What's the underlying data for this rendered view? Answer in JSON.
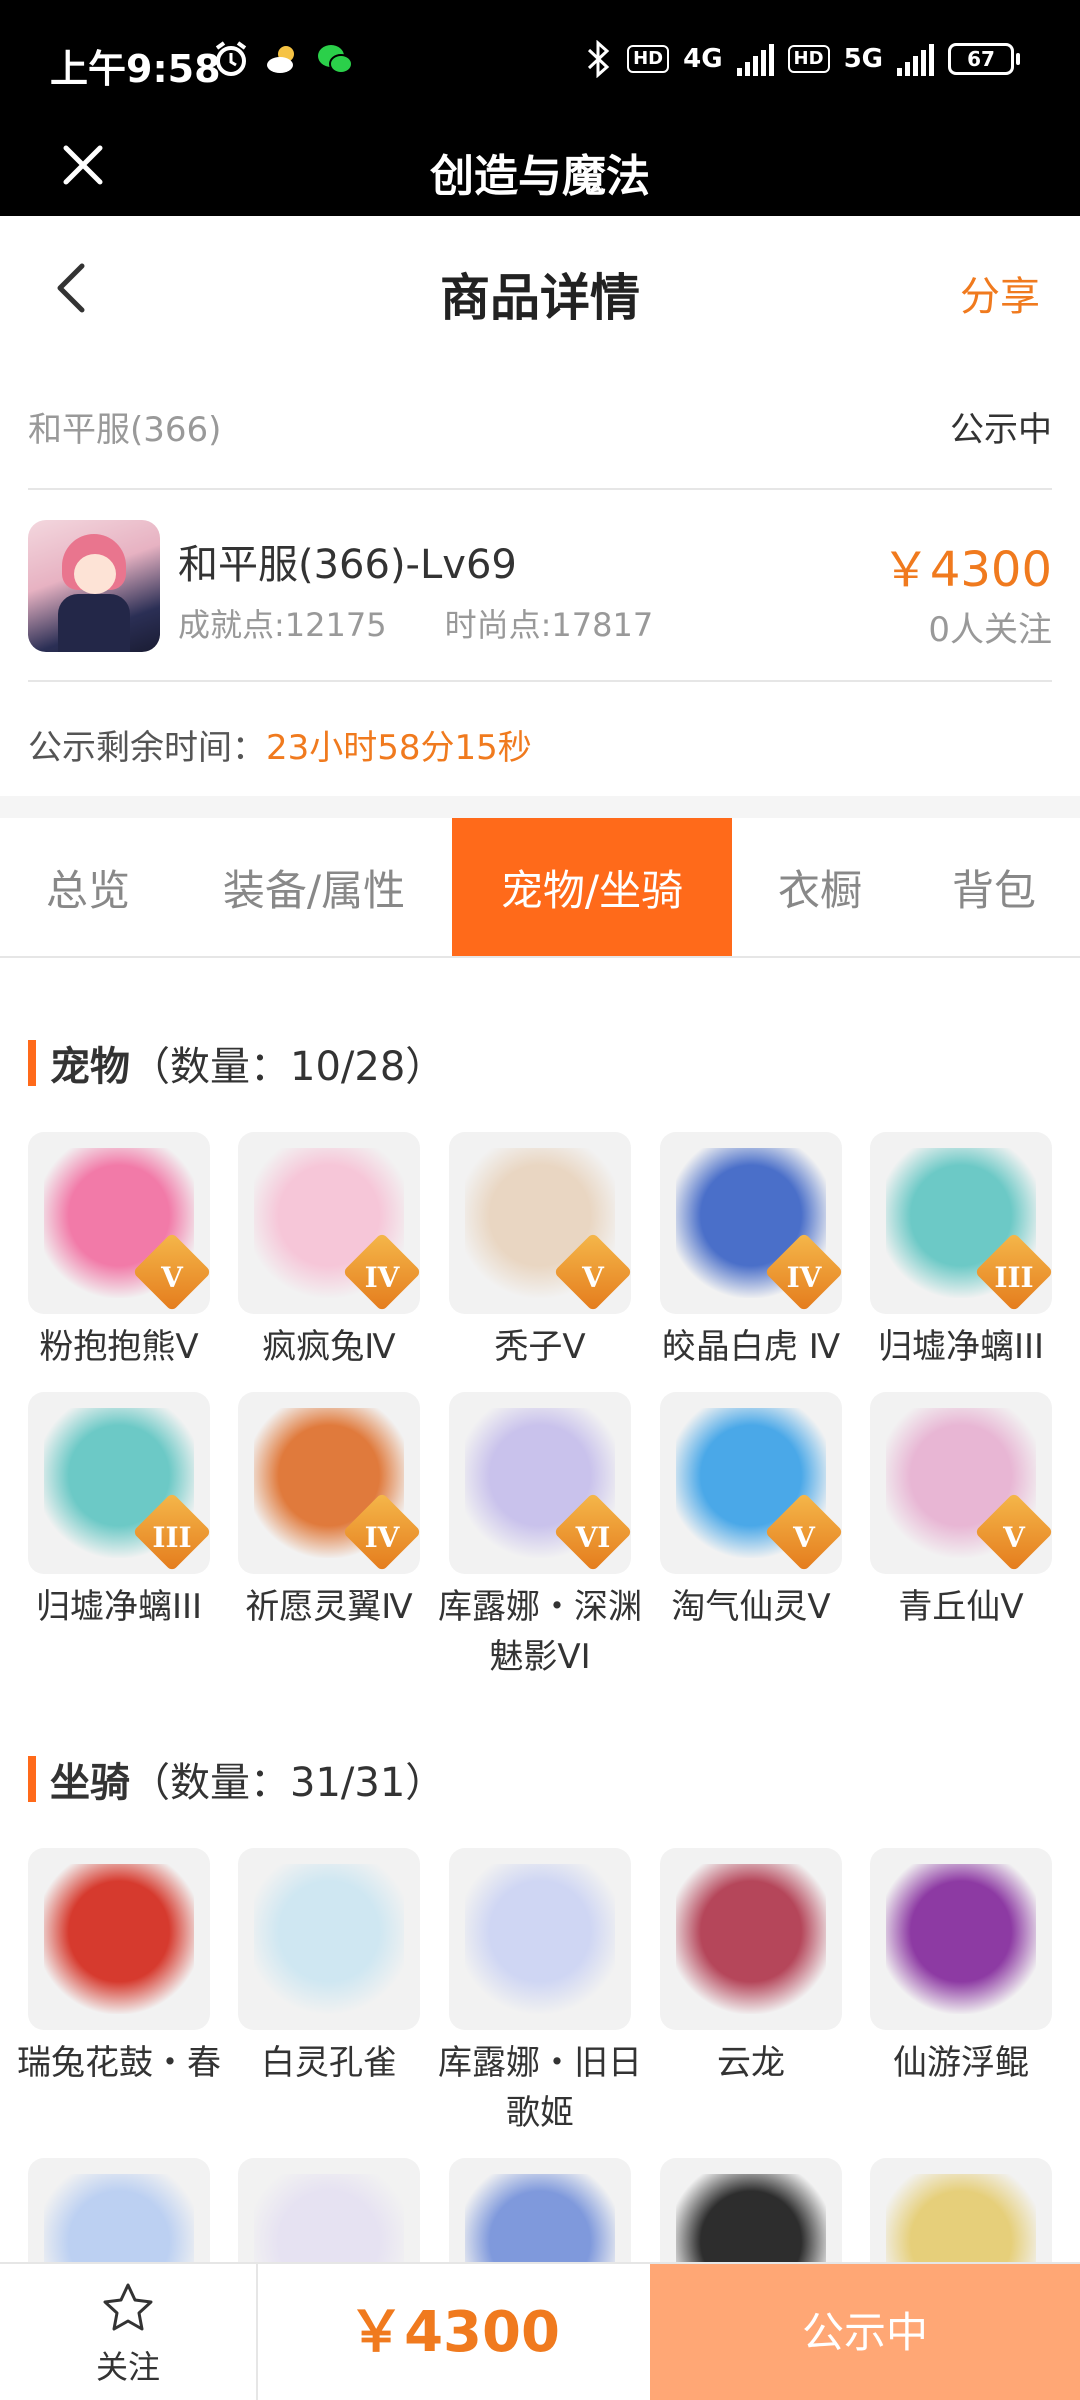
{
  "status_bar": {
    "time": "上午9:58",
    "network_4g": "4G",
    "network_5g": "5G",
    "hd": "HD",
    "battery": "67"
  },
  "app_bar": {
    "title": "创造与魔法"
  },
  "header": {
    "title": "商品详情",
    "share": "分享"
  },
  "server": {
    "name": "和平服(366)",
    "status": "公示中"
  },
  "product": {
    "name": "和平服(366)-Lv69",
    "achievement": "成就点:12175",
    "fashion": "时尚点:17817",
    "price": "￥4300",
    "followers": "0人关注"
  },
  "countdown": {
    "label": "公示剩余时间：",
    "remaining": "23小时58分15秒"
  },
  "tabs": [
    "总览",
    "装备/属性",
    "宠物/坐骑",
    "衣橱",
    "背包"
  ],
  "active_tab": "宠物/坐骑",
  "pets": {
    "title": "宠物",
    "count": "（数量：10/28）",
    "items": [
      {
        "name": "粉抱抱熊Ⅴ",
        "badge": "V",
        "color": "#f27aa8"
      },
      {
        "name": "疯疯兔Ⅳ",
        "badge": "IV",
        "color": "#f6c6d8"
      },
      {
        "name": "秃子V",
        "badge": "V",
        "color": "#e9d6c2"
      },
      {
        "name": "皎晶白虎 Ⅳ",
        "badge": "IV",
        "color": "#4a6fc9"
      },
      {
        "name": "归墟净螭III",
        "badge": "III",
        "color": "#6cc9c6"
      },
      {
        "name": "归墟净螭III",
        "badge": "III",
        "color": "#6cc9c6"
      },
      {
        "name": "祈愿灵翼Ⅳ",
        "badge": "IV",
        "color": "#e07a3c"
      },
      {
        "name": "库露娜・深渊魅影VI",
        "badge": "VI",
        "color": "#c9c2ec"
      },
      {
        "name": "淘气仙灵V",
        "badge": "V",
        "color": "#4aa8e8"
      },
      {
        "name": "青丘仙V",
        "badge": "V",
        "color": "#e8b6d4"
      }
    ]
  },
  "mounts": {
    "title": "坐骑",
    "count": "（数量：31/31）",
    "items": [
      {
        "name": "瑞兔花鼓・春",
        "color": "#d63a2e"
      },
      {
        "name": "白灵孔雀",
        "color": "#cfe7f2"
      },
      {
        "name": "库露娜・旧日歌姬",
        "color": "#cfd6f3"
      },
      {
        "name": "云龙",
        "color": "#b5465a"
      },
      {
        "name": "仙游浮鲲",
        "color": "#8d3aa3"
      },
      {
        "name": "",
        "color": "#bcd0f2"
      },
      {
        "name": "",
        "color": "#e6e2f2"
      },
      {
        "name": "",
        "color": "#7f99dc"
      },
      {
        "name": "",
        "color": "#2d2d2d"
      },
      {
        "name": "",
        "color": "#e6cf7a"
      }
    ]
  },
  "bottom_bar": {
    "follow": "关注",
    "price": "￥4300",
    "action": "公示中"
  }
}
